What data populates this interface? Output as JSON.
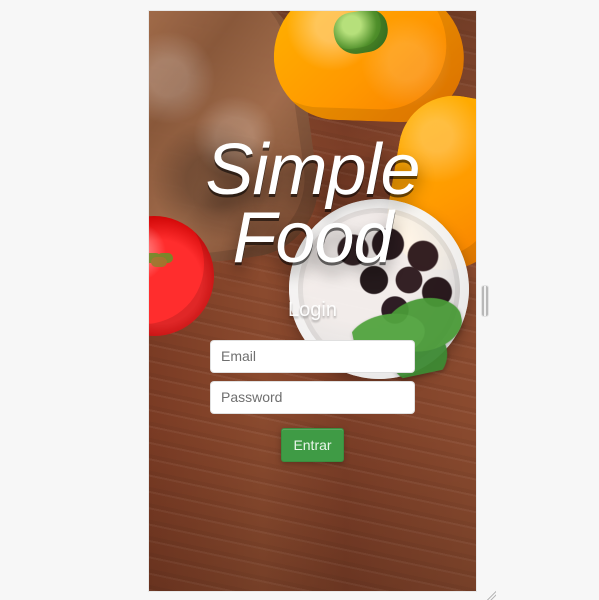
{
  "app": {
    "logo_line1": "Simple",
    "logo_line2": "Food",
    "login_title": "Login"
  },
  "form": {
    "email": {
      "value": "",
      "placeholder": "Email"
    },
    "password": {
      "value": "",
      "placeholder": "Password"
    },
    "submit_label": "Entrar"
  },
  "icons": {
    "resize_handle": "resize-handle-icon",
    "corner_grip": "resize-corner-icon"
  },
  "colors": {
    "button_green": "#3f9b45"
  }
}
